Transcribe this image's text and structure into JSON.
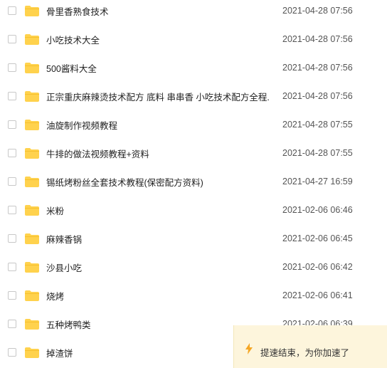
{
  "files": [
    {
      "name": "骨里香熟食技术",
      "date": "2021-04-28 07:56"
    },
    {
      "name": "小吃技术大全",
      "date": "2021-04-28 07:56"
    },
    {
      "name": "500酱料大全",
      "date": "2021-04-28 07:56"
    },
    {
      "name": "正宗重庆麻辣烫技术配方 底料 串串香 小吃技术配方全程...",
      "date": "2021-04-28 07:56"
    },
    {
      "name": "油旋制作视频教程",
      "date": "2021-04-28 07:55"
    },
    {
      "name": "牛排的做法视频教程+资料",
      "date": "2021-04-28 07:55"
    },
    {
      "name": "锡纸烤粉丝全套技术教程(保密配方资料)",
      "date": "2021-04-27 16:59"
    },
    {
      "name": "米粉",
      "date": "2021-02-06 06:46"
    },
    {
      "name": "麻辣香锅",
      "date": "2021-02-06 06:45"
    },
    {
      "name": "沙县小吃",
      "date": "2021-02-06 06:42"
    },
    {
      "name": "烧烤",
      "date": "2021-02-06 06:41"
    },
    {
      "name": "五种烤鸭类",
      "date": "2021-02-06 06:39"
    },
    {
      "name": "掉渣饼",
      "date": ""
    }
  ],
  "toast": {
    "icon": "lightning-icon",
    "message": "提速结束，为你加速了",
    "accent": "#f5a623"
  },
  "colors": {
    "folder": "#ffd24d",
    "folder_tab": "#f6c02e"
  }
}
